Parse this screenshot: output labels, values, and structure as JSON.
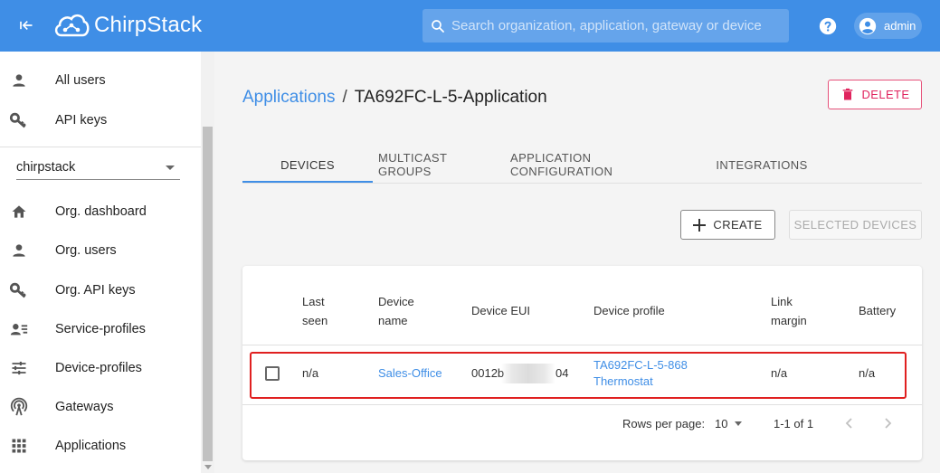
{
  "header": {
    "brand": "ChirpStack",
    "search_placeholder": "Search organization, application, gateway or device",
    "user": "admin",
    "icons": [
      "back-arrow-icon",
      "cloud-logo-icon",
      "search-icon",
      "help-icon",
      "account-circle-icon"
    ]
  },
  "sidebar": {
    "top_items": [
      {
        "label": "All users",
        "icon": "person-icon"
      },
      {
        "label": "API keys",
        "icon": "key-icon"
      }
    ],
    "org_select": "chirpstack",
    "org_items": [
      {
        "label": "Org. dashboard",
        "icon": "home-icon"
      },
      {
        "label": "Org. users",
        "icon": "person-icon"
      },
      {
        "label": "Org. API keys",
        "icon": "key-icon"
      },
      {
        "label": "Service-profiles",
        "icon": "account-details-icon"
      },
      {
        "label": "Device-profiles",
        "icon": "tune-icon"
      },
      {
        "label": "Gateways",
        "icon": "radio-tower-icon"
      },
      {
        "label": "Applications",
        "icon": "apps-grid-icon"
      }
    ]
  },
  "main": {
    "breadcrumb": {
      "link": "Applications",
      "separator": "/",
      "current": "TA692FC-L-5-Application"
    },
    "delete_label": "DELETE",
    "tabs": [
      "DEVICES",
      "MULTICAST GROUPS",
      "APPLICATION CONFIGURATION",
      "INTEGRATIONS"
    ],
    "active_tab": "DEVICES",
    "create_label": "CREATE",
    "selected_devices_label": "SELECTED DEVICES",
    "table": {
      "headers": {
        "last_seen": [
          "Last",
          "seen"
        ],
        "device_name": [
          "Device",
          "name"
        ],
        "device_eui": "Device EUI",
        "device_profile": "Device profile",
        "link_margin": [
          "Link",
          "margin"
        ],
        "battery": "Battery"
      },
      "rows": [
        {
          "last_seen": "n/a",
          "device_name": "Sales-Office",
          "device_eui_start": "0012b",
          "device_eui_end": "04",
          "device_profile": [
            "TA692FC-L-5-868",
            "Thermostat"
          ],
          "link_margin": "n/a",
          "battery": "n/a"
        }
      ]
    },
    "pagination": {
      "rows_per_page_label": "Rows per page:",
      "rows_per_page": "10",
      "range": "1-1 of 1"
    }
  },
  "colors": {
    "primary": "#3f8ee6",
    "danger": "#e0245e",
    "highlight": "#e02020"
  }
}
